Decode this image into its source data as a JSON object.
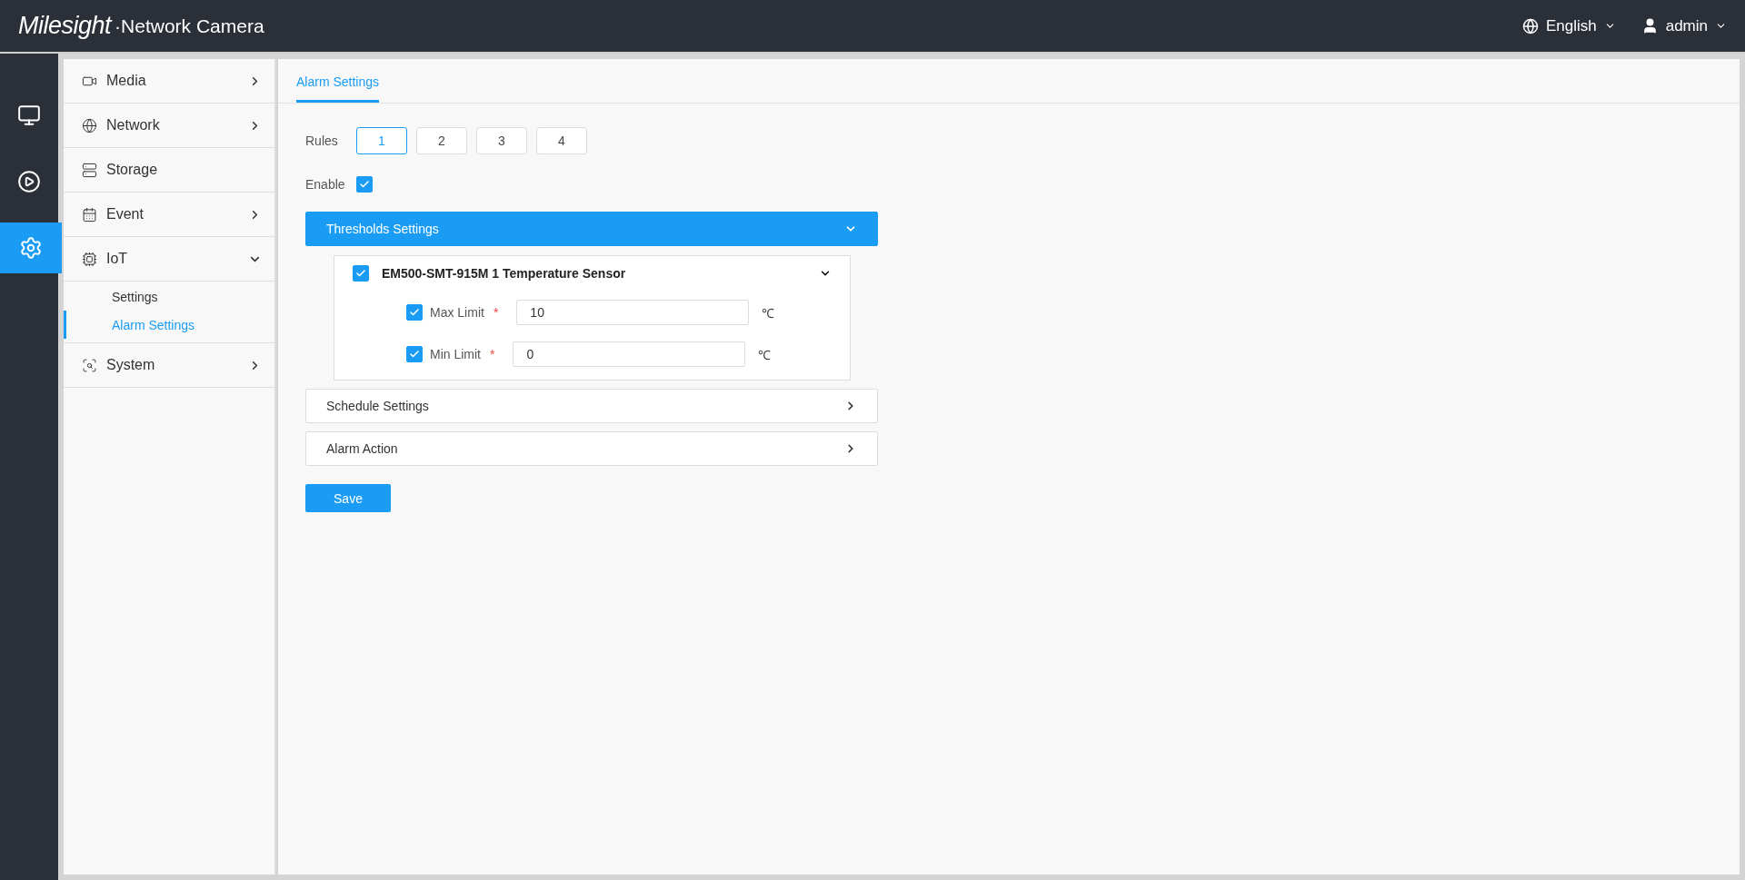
{
  "header": {
    "brand": "Milesight",
    "title": "·Network Camera",
    "language": "English",
    "user": "admin"
  },
  "rail": [
    {
      "kind": "live",
      "selected": false
    },
    {
      "kind": "playback",
      "selected": false
    },
    {
      "kind": "settings",
      "selected": true
    }
  ],
  "menu": [
    {
      "label": "Media",
      "kind": "media",
      "has_children": true,
      "expanded": false
    },
    {
      "label": "Network",
      "kind": "network",
      "has_children": true,
      "expanded": false
    },
    {
      "label": "Storage",
      "kind": "storage",
      "has_children": false
    },
    {
      "label": "Event",
      "kind": "event",
      "has_children": true,
      "expanded": false
    },
    {
      "label": "IoT",
      "kind": "iot",
      "has_children": true,
      "expanded": true,
      "children": [
        {
          "label": "Settings",
          "selected": false
        },
        {
          "label": "Alarm Settings",
          "selected": true
        }
      ]
    },
    {
      "label": "System",
      "kind": "system",
      "has_children": true,
      "expanded": false
    }
  ],
  "tabs": [
    {
      "label": "Alarm Settings",
      "selected": true
    }
  ],
  "rules": {
    "label": "Rules",
    "options": [
      {
        "label": "1",
        "selected": true
      },
      {
        "label": "2",
        "selected": false
      },
      {
        "label": "3",
        "selected": false
      },
      {
        "label": "4",
        "selected": false
      }
    ]
  },
  "enable": {
    "label": "Enable",
    "checked": true
  },
  "sections": [
    {
      "title": "Thresholds Settings",
      "expanded": true,
      "sensors": [
        {
          "name": "EM500-SMT-915M 1 Temperature Sensor",
          "checked": true,
          "expanded": true,
          "limits": [
            {
              "label": "Max Limit",
              "checked": true,
              "required": "*",
              "value": "10",
              "unit": "℃"
            },
            {
              "label": "Min Limit",
              "checked": true,
              "required": "*",
              "value": "0",
              "unit": "℃"
            }
          ]
        }
      ]
    },
    {
      "title": "Schedule Settings",
      "expanded": false
    },
    {
      "title": "Alarm Action",
      "expanded": false
    }
  ],
  "save": "Save"
}
